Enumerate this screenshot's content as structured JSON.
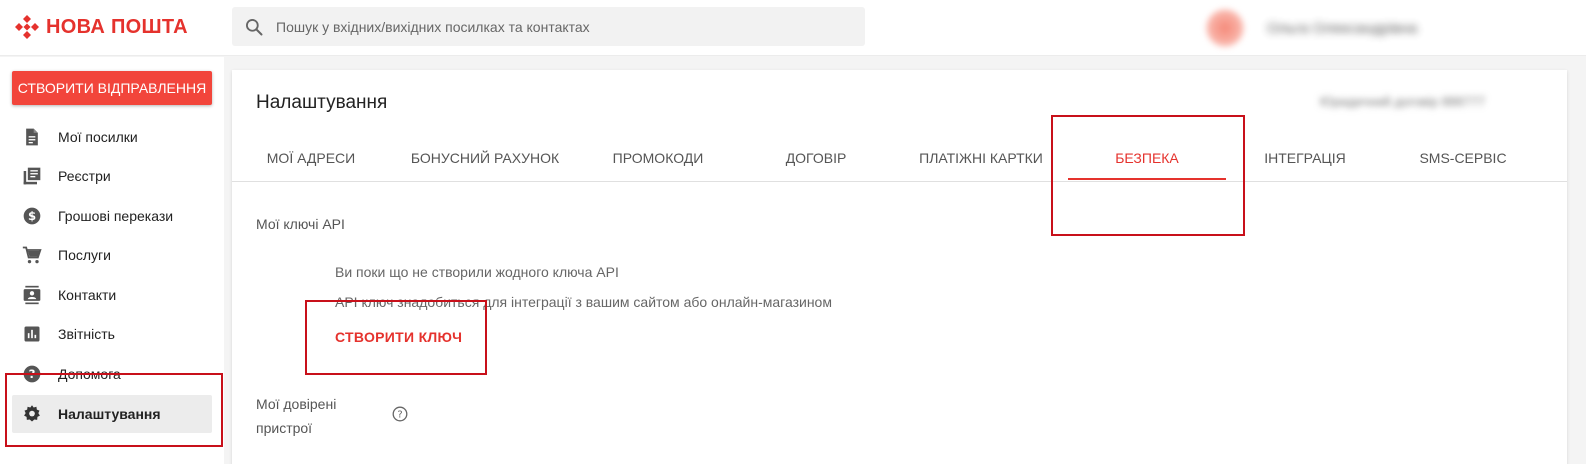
{
  "brand": {
    "name": "НОВА ПОШТА",
    "color": "#e5322d"
  },
  "search": {
    "placeholder": "Пошук у вхідних/вихідних посилках та контактах"
  },
  "user": {
    "name": "Ольга Олександрівна"
  },
  "sidebar": {
    "create_label": "СТВОРИТИ ВІДПРАВЛЕННЯ",
    "items": [
      {
        "label": "Мої посилки",
        "icon": "document-icon"
      },
      {
        "label": "Реєстри",
        "icon": "registry-icon"
      },
      {
        "label": "Грошові перекази",
        "icon": "dollar-icon"
      },
      {
        "label": "Послуги",
        "icon": "cart-icon"
      },
      {
        "label": "Контакти",
        "icon": "contacts-icon"
      },
      {
        "label": "Звітність",
        "icon": "chart-icon"
      },
      {
        "label": "Допомога",
        "icon": "help-icon"
      },
      {
        "label": "Налаштування",
        "icon": "gear-icon",
        "active": true
      }
    ]
  },
  "main": {
    "title": "Налаштування",
    "contract": "Юридичний договір 888777",
    "tabs": [
      {
        "label": "МОЇ АДРЕСИ"
      },
      {
        "label": "БОНУСНИЙ РАХУНОК"
      },
      {
        "label": "ПРОМОКОДИ"
      },
      {
        "label": "ДОГОВІР"
      },
      {
        "label": "ПЛАТІЖНІ КАРТКИ"
      },
      {
        "label": "БЕЗПЕКА",
        "active": true
      },
      {
        "label": "ІНТЕГРАЦІЯ"
      },
      {
        "label": "SMS-СЕРВІС"
      }
    ],
    "api_section": {
      "label": "Мої ключі API",
      "empty_text": "Ви поки що не створили жодного ключа API",
      "hint_text": "API ключ знадобиться для інтеграції з вашим сайтом або онлайн-магазином",
      "create_key_label": "СТВОРИТИ КЛЮЧ"
    },
    "devices_section": {
      "label": "Мої довірені пристрої"
    }
  },
  "colors": {
    "accent": "#e5322d",
    "button": "#f2453b",
    "annotation": "#c8101a"
  }
}
